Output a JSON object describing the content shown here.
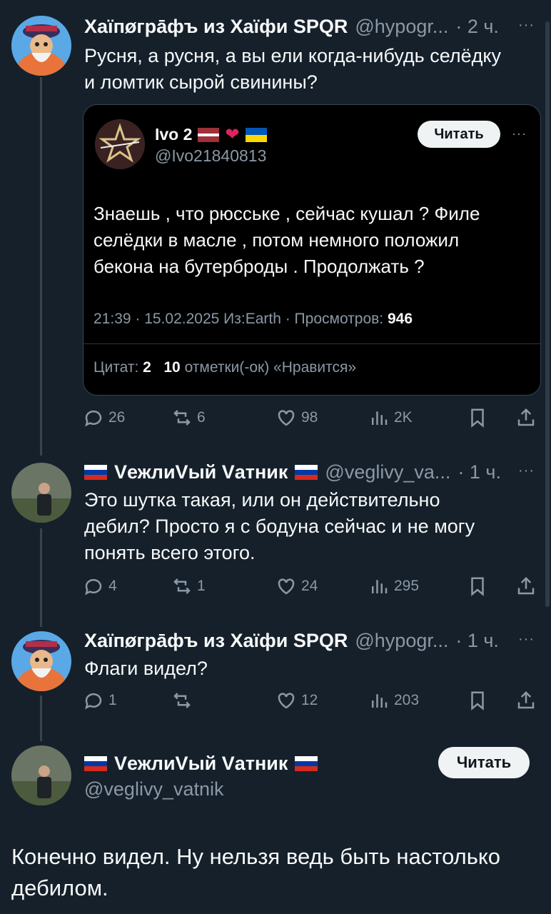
{
  "post1": {
    "display_name": "Хаїпøгрāфъ из Хаїфи SPQR",
    "handle": "@hypogr...",
    "time": "· 2 ч.",
    "text_line1": "Русня, а русня, а вы ели когда-нибудь селёдку",
    "text_line2": "и ломтик сырой свинины?",
    "quote": {
      "display_name": "Ivo 2",
      "handle": "@Ivo21840813",
      "follow_label": "Читать",
      "text_line1": "Знаешь , что рюсське , сейчас кушал ? Филе",
      "text_line2": "селёдки в масле , потом немного положил",
      "text_line3": "бекона  на бутерброды . Продолжать ?",
      "meta": "21:39 · 15.02.2025 Из:Earth · Просмотров:",
      "views": "946",
      "quotes_label": "Цитат:",
      "quotes_count": "2",
      "likes_count": "10",
      "likes_label": "отметки(-ок) «Нравится»"
    },
    "replies": "26",
    "reposts": "6",
    "likes": "98",
    "views": "2K"
  },
  "post2": {
    "display_name": "VежлиVый Vатник",
    "handle": "@veglivy_va...",
    "time": "· 1 ч.",
    "text_line1": "Это шутка такая, или он действительно",
    "text_line2": "дебил? Просто я с бодуна сейчас и не могу",
    "text_line3": "понять всего этого.",
    "replies": "4",
    "reposts": "1",
    "likes": "24",
    "views": "295"
  },
  "post3": {
    "display_name": "Хаїпøгрāфъ из Хаїфи SPQR",
    "handle": "@hypogr...",
    "time": "· 1 ч.",
    "text_line1": "Флаги видел?",
    "replies": "1",
    "reposts": "",
    "likes": "12",
    "views": "203"
  },
  "main": {
    "display_name": "VежлиVый Vатник",
    "handle": "@veglivy_vatnik",
    "follow_label": "Читать",
    "text_line1": "Конечно видел. Ну нельзя ведь быть настолько",
    "text_line2": "дебилом."
  },
  "more_label": "···",
  "colors": {
    "background": "#15202b",
    "muted": "#8b98a5",
    "text": "#f7f9f9",
    "thread_line": "#38444d"
  }
}
